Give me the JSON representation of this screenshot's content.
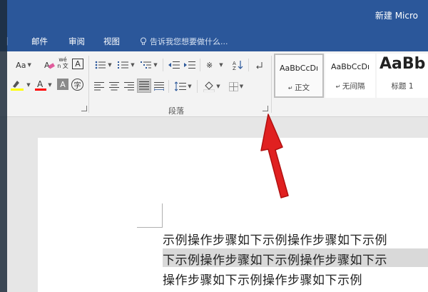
{
  "window": {
    "title": "新建 Micro"
  },
  "tabs": [
    {
      "label": "邮件"
    },
    {
      "label": "审阅"
    },
    {
      "label": "视图"
    }
  ],
  "tell_me": {
    "text": "告诉我您想要做什么..."
  },
  "ribbon": {
    "font": {
      "change_case": "Aa",
      "phonetic": "wén 文",
      "char_border": "A",
      "enclose_char": "字"
    },
    "paragraph": {
      "group_label": "段落"
    },
    "styles": [
      {
        "sample": "AaBbCcDı",
        "name": "正文",
        "selected": true
      },
      {
        "sample": "AaBbCcDı",
        "name": "无间隔",
        "selected": false
      },
      {
        "sample": "AaBb",
        "name": "标题 1",
        "selected": false
      }
    ]
  },
  "document": {
    "lines": [
      "示例操作步骤如下示例操作步骤如下示例",
      "下示例操作步骤如下示例操作步骤如下示",
      "操作步骤如下示例操作步骤如下示例"
    ]
  },
  "accent_colors": {
    "titlebar": "#2b579a",
    "arrow": "#e02020",
    "highlight": "#ffff00",
    "font_color": "#ff0000"
  }
}
